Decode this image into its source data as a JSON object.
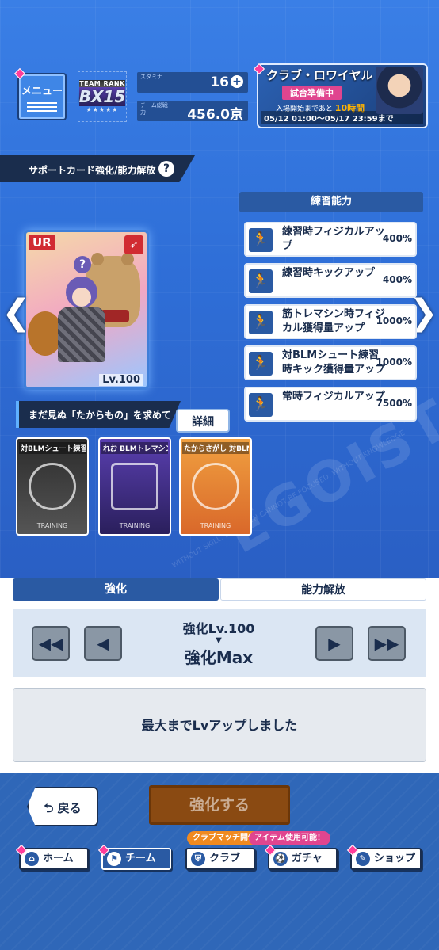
{
  "header": {
    "menu_label": "メニュー",
    "rank_label": "TEAM RANK",
    "rank_value": "BX15",
    "stamina_label": "スタミナ",
    "stamina_value": "16",
    "power_label": "チーム総戦力",
    "power_value": "456.0京"
  },
  "club_banner": {
    "title": "クラブ・ロワイヤル",
    "status": "試合準備中",
    "open_prefix": "入場開始まであと",
    "open_time": "10時間",
    "period": "05/12 01:00～05/17 23:59まで"
  },
  "section_title": "サポートカード強化/能力解放",
  "card": {
    "rarity": "UR",
    "level": "Lv.100"
  },
  "ability": {
    "header": "練習能力",
    "items": [
      {
        "name": "練習時フィジカルアップ",
        "value": "400%"
      },
      {
        "name": "練習時キックアップ",
        "value": "400%"
      },
      {
        "name": "筋トレマシン時フィジカル獲得量アップ",
        "value": "1000%"
      },
      {
        "name": "対BLMシュート練習時キック獲得量アップ",
        "value": "1000%"
      },
      {
        "name": "常時フィジカルアップ",
        "value": "7500%"
      }
    ]
  },
  "treasure": {
    "title": "まだ見ぬ「たからもの」を求めて",
    "detail": "詳細",
    "items": [
      {
        "label": "対BLMシュート練習",
        "foot": "TRAINING"
      },
      {
        "label": "れお BLMトレマシン",
        "foot": "TRAINING"
      },
      {
        "label": "たからさがし 対BLMシュート練習",
        "foot": "TRAINING"
      }
    ]
  },
  "tabs": {
    "enhance": "強化",
    "unlock": "能力解放"
  },
  "level": {
    "current": "強化Lv.100",
    "arrow": "▼",
    "max": "強化Max"
  },
  "message": "最大までLvアップしました",
  "buttons": {
    "back": "戻る",
    "enhance": "強化する"
  },
  "nav": {
    "home": "ホーム",
    "team": "チーム",
    "club": "クラブ",
    "gacha": "ガチャ",
    "shop": "ショップ",
    "club_badge": "クラブマッチ開催中",
    "gacha_badge": "アイテム使用可能！"
  },
  "colors": {
    "primary": "#2a5aa3",
    "dark": "#1a2d4d",
    "accent_pink": "#e0458f",
    "accent_orange": "#f08a20",
    "enhance_btn": "#8a4a12"
  }
}
